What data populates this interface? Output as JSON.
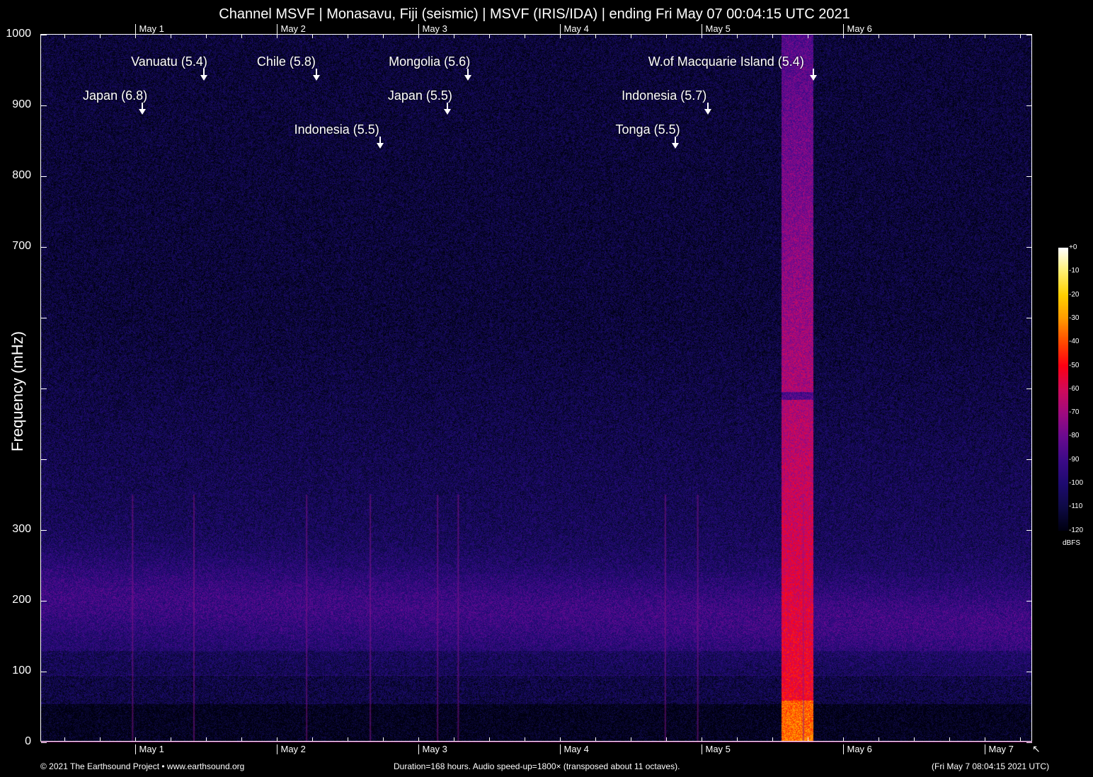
{
  "chart_data": {
    "type": "heatmap",
    "title": "Channel MSVF | Monasavu, Fiji (seismic) | MSVF (IRIS/IDA) | ending Fri May 07 00:04:15 UTC 2021",
    "ylabel": "Frequency (mHz)",
    "xlabel": "",
    "ylim": [
      0,
      1000
    ],
    "xlim_hours": [
      0,
      168
    ],
    "yticks": [
      {
        "value": 0,
        "label": "0"
      },
      {
        "value": 100,
        "label": "100"
      },
      {
        "value": 200,
        "label": "200"
      },
      {
        "value": 300,
        "label": "300"
      },
      {
        "value": 400,
        "label": ""
      },
      {
        "value": 500,
        "label": ""
      },
      {
        "value": 600,
        "label": ""
      },
      {
        "value": 700,
        "label": "700"
      },
      {
        "value": 800,
        "label": "800"
      },
      {
        "value": 900,
        "label": "900"
      },
      {
        "value": 1000,
        "label": "1000"
      }
    ],
    "xticks_top": [
      {
        "hour": 15.9,
        "label": "May  1"
      },
      {
        "hour": 39.9,
        "label": "May  2"
      },
      {
        "hour": 63.9,
        "label": "May  3"
      },
      {
        "hour": 87.9,
        "label": "May  4"
      },
      {
        "hour": 111.9,
        "label": "May  5"
      },
      {
        "hour": 135.9,
        "label": "May  6"
      }
    ],
    "xticks_bottom": [
      {
        "hour": 15.9,
        "label": "May  1"
      },
      {
        "hour": 39.9,
        "label": "May  2"
      },
      {
        "hour": 63.9,
        "label": "May  3"
      },
      {
        "hour": 87.9,
        "label": "May  4"
      },
      {
        "hour": 111.9,
        "label": "May  5"
      },
      {
        "hour": 135.9,
        "label": "May  6"
      },
      {
        "hour": 159.9,
        "label": "May  7"
      }
    ],
    "events": [
      {
        "label": "Japan (6.8)",
        "hour": 17.2,
        "row": 2
      },
      {
        "label": "Vanuatu (5.4)",
        "hour": 27.6,
        "row": 1
      },
      {
        "label": "Chile (5.8)",
        "hour": 46.7,
        "row": 1
      },
      {
        "label": "Indonesia (5.5)",
        "hour": 57.5,
        "row": 3
      },
      {
        "label": "Japan (5.5)",
        "hour": 68.9,
        "row": 2
      },
      {
        "label": "Mongolia (5.6)",
        "hour": 72.4,
        "row": 1
      },
      {
        "label": "Tonga (5.5)",
        "hour": 107.5,
        "row": 3
      },
      {
        "label": "Indonesia (5.7)",
        "hour": 113.0,
        "row": 2
      },
      {
        "label": "W.of Macquarie Island (5.4)",
        "hour": 130.9,
        "row": 1
      }
    ],
    "colorbar": {
      "unit": "dBFS",
      "range": [
        -120,
        0
      ],
      "ticks": [
        "+0",
        "-10",
        "-20",
        "-30",
        "-40",
        "-50",
        "-60",
        "-70",
        "-80",
        "-90",
        "-100",
        "-110",
        "-120"
      ],
      "stops": [
        "#000010",
        "#0e0a45",
        "#1e0a70",
        "#3c0a88",
        "#6a0a90",
        "#a00a80",
        "#d00a5a",
        "#ff0014",
        "#ff4a00",
        "#ff9a00",
        "#ffd000",
        "#fff070",
        "#ffffff"
      ]
    },
    "strong_signal_hours": [
      125.5,
      130.8
    ]
  },
  "footer": {
    "left": "© 2021 The Earthsound Project • www.earthsound.org",
    "center": "Duration=168 hours. Audio speed-up=1800× (transposed about 11 octaves).",
    "right": "(Fri May  7 08:04:15 2021 UTC)"
  }
}
